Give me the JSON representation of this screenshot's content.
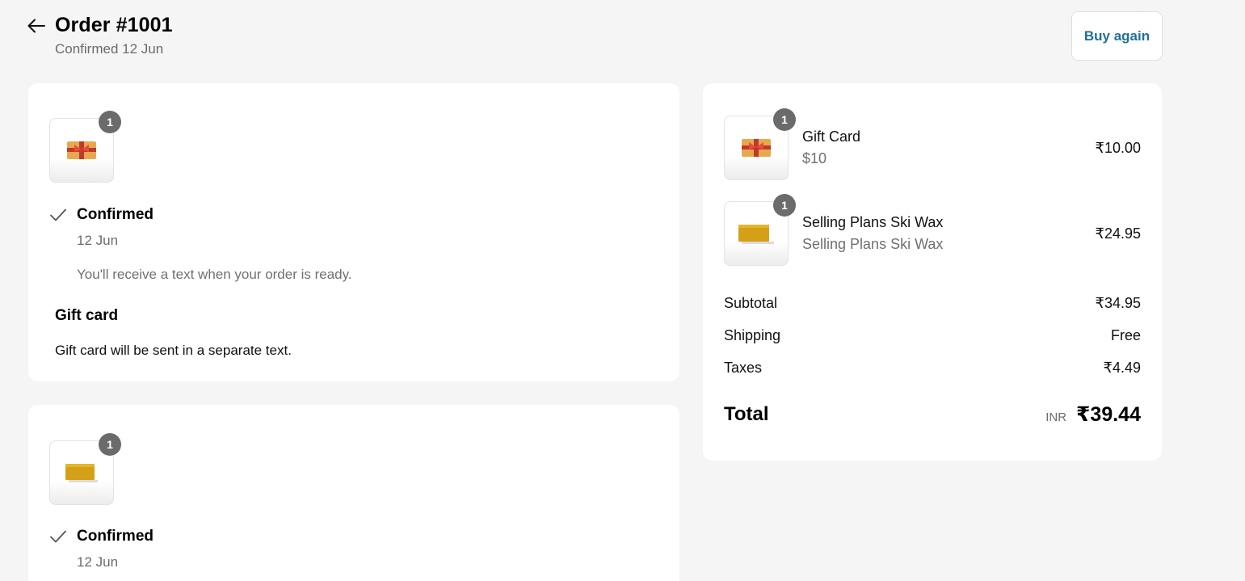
{
  "header": {
    "title": "Order #1001",
    "subtitle": "Confirmed 12 Jun",
    "buy_again_label": "Buy again"
  },
  "fulfillments": [
    {
      "quantity": "1",
      "image_icon": "gift-card-image",
      "status": "Confirmed",
      "date": "12 Jun",
      "note": "You'll receive a text when your order is ready.",
      "section_heading": "Gift card",
      "section_text": "Gift card will be sent in a separate text."
    },
    {
      "quantity": "1",
      "image_icon": "ski-wax-image",
      "status": "Confirmed",
      "date": "12 Jun"
    }
  ],
  "summary": {
    "items": [
      {
        "name": "Gift Card",
        "variant": "$10",
        "price": "₹10.00",
        "quantity": "1",
        "image_icon": "gift-card-image"
      },
      {
        "name": "Selling Plans Ski Wax",
        "variant": "Selling Plans Ski Wax",
        "price": "₹24.95",
        "quantity": "1",
        "image_icon": "ski-wax-image"
      }
    ],
    "subtotal_label": "Subtotal",
    "subtotal_value": "₹34.95",
    "shipping_label": "Shipping",
    "shipping_value": "Free",
    "taxes_label": "Taxes",
    "taxes_value": "₹4.49",
    "total_label": "Total",
    "currency": "INR",
    "total_value": "₹39.44"
  },
  "colors": {
    "background": "#f5f5f5",
    "card": "#ffffff",
    "accent_link": "#1f6f9a",
    "badge": "#6b6b6b"
  }
}
